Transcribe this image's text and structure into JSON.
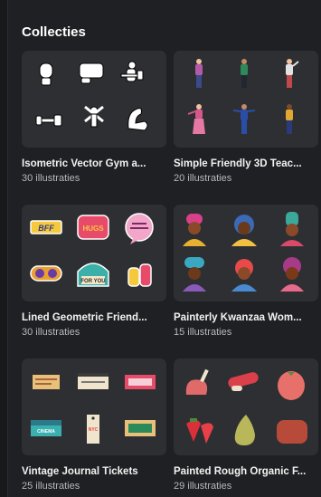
{
  "section": {
    "title": "Collecties"
  },
  "collections": [
    {
      "title": "Isometric Vector Gym a...",
      "count": "30 illustraties",
      "icons": [
        "boxing-glove-icon",
        "fist-icon",
        "dumbbell-person-icon",
        "dumbbell-icon",
        "jumping-jack-icon",
        "flexed-arm-icon"
      ]
    },
    {
      "title": "Simple Friendly 3D Teac...",
      "count": "20 illustraties",
      "icons": [
        "teacher-figure-icon",
        "teacher-figure-icon",
        "teacher-figure-icon",
        "teacher-figure-icon",
        "teacher-figure-icon",
        "teacher-figure-icon"
      ]
    },
    {
      "title": "Lined Geometric Friend...",
      "count": "30 illustraties",
      "icons": [
        "bff-sticker-icon",
        "hugs-sticker-icon",
        "speech-bubble-sticker-icon",
        "glasses-sticker-icon",
        "for-you-sticker-icon",
        "friends-sticker-icon"
      ]
    },
    {
      "title": "Painterly Kwanzaa Wom...",
      "count": "15 illustraties",
      "icons": [
        "woman-portrait-icon",
        "woman-portrait-icon",
        "woman-portrait-icon",
        "woman-portrait-icon",
        "woman-portrait-icon",
        "woman-portrait-icon"
      ]
    },
    {
      "title": "Vintage Journal Tickets",
      "count": "25 illustraties",
      "icons": [
        "ticket-icon",
        "ticket-icon",
        "ticket-icon",
        "ticket-icon",
        "tag-ticket-icon",
        "ticket-icon"
      ]
    },
    {
      "title": "Painted Rough Organic F...",
      "count": "29 illustraties",
      "icons": [
        "meat-icon",
        "sausage-icon",
        "tomato-icon",
        "strawberry-icon",
        "pear-icon",
        "bread-icon"
      ]
    }
  ],
  "sticker_text": {
    "bff": "BFF",
    "hugs": "HUGS",
    "for_you": "FOR YOU",
    "cinema": "CINEMA",
    "nyc": "NYC"
  },
  "colors": {
    "background": "#1f2023",
    "thumb": "#2e2f33",
    "subtext": "#b7b8bc"
  }
}
